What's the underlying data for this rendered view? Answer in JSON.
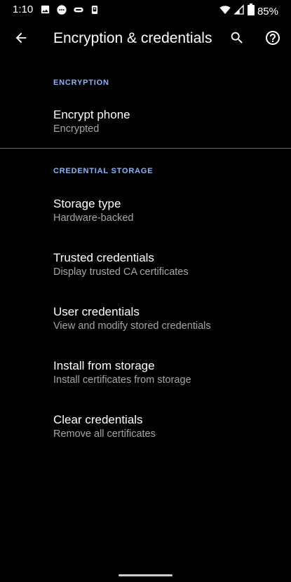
{
  "status_bar": {
    "time": "1:10",
    "notification_icons": [
      "image-icon",
      "chat-bubble-icon",
      "voicemail-icon",
      "phone-device-icon"
    ],
    "battery": "85%"
  },
  "app_bar": {
    "title": "Encryption & credentials"
  },
  "sections": {
    "encryption": {
      "header": "ENCRYPTION",
      "items": [
        {
          "title": "Encrypt phone",
          "summary": "Encrypted"
        }
      ]
    },
    "credential_storage": {
      "header": "CREDENTIAL STORAGE",
      "items": [
        {
          "title": "Storage type",
          "summary": "Hardware-backed"
        },
        {
          "title": "Trusted credentials",
          "summary": "Display trusted CA certificates"
        },
        {
          "title": "User credentials",
          "summary": "View and modify stored credentials"
        },
        {
          "title": "Install from storage",
          "summary": "Install certificates from storage"
        },
        {
          "title": "Clear credentials",
          "summary": "Remove all certificates"
        }
      ]
    }
  },
  "colors": {
    "background": "#000000",
    "accent": "#8ab4f8",
    "summary_text": "#a6a6a6"
  }
}
